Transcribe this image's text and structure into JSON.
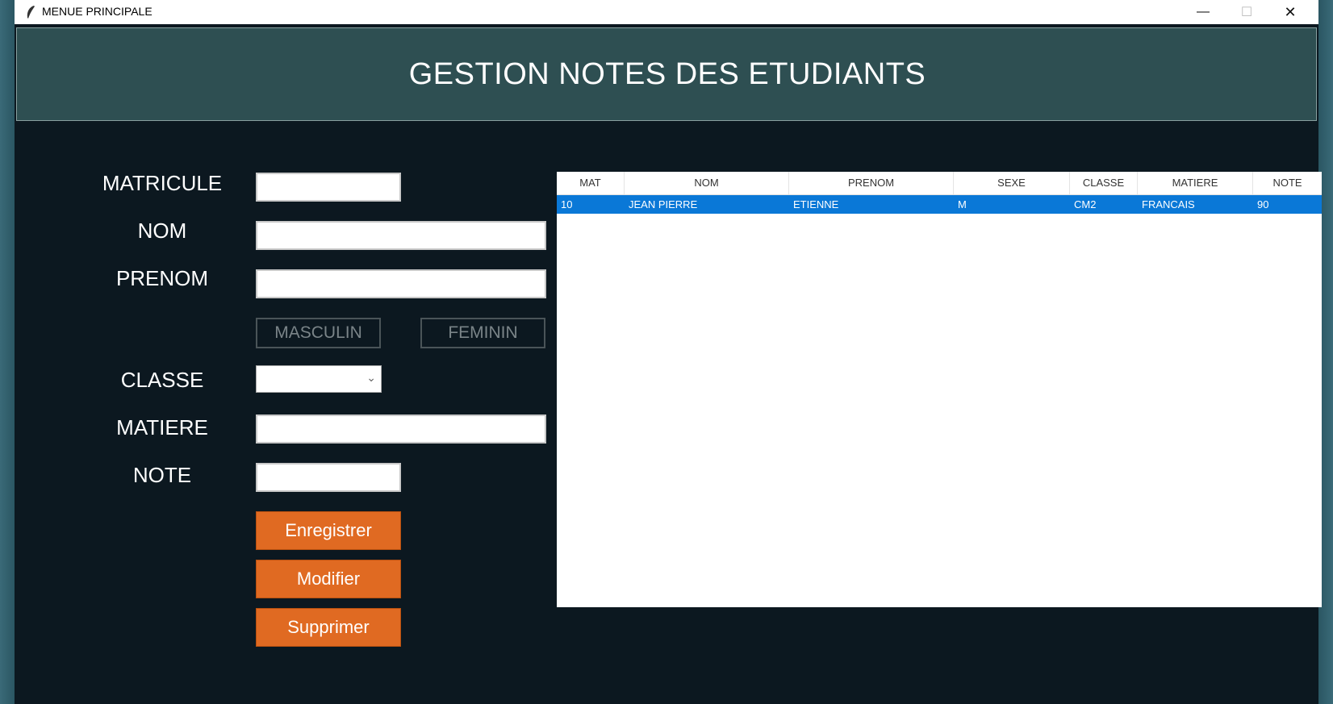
{
  "window": {
    "title": "MENUE PRINCIPALE",
    "minimize": "—",
    "maximize": "☐",
    "close": "✕"
  },
  "header": {
    "title": "GESTION NOTES DES ETUDIANTS"
  },
  "form": {
    "matricule_label": "MATRICULE",
    "nom_label": "NOM",
    "prenom_label": "PRENOM",
    "classe_label": "CLASSE",
    "matiere_label": "MATIERE",
    "note_label": "NOTE",
    "matricule_value": "",
    "nom_value": "",
    "prenom_value": "",
    "classe_value": "",
    "matiere_value": "",
    "note_value": "",
    "masculin_label": "MASCULIN",
    "feminin_label": "FEMININ"
  },
  "buttons": {
    "save": "Enregistrer",
    "modify": "Modifier",
    "delete": "Supprimer"
  },
  "table": {
    "columns": [
      "MAT",
      "NOM",
      "PRENOM",
      "SEXE",
      "CLASSE",
      "MATIERE",
      "NOTE"
    ],
    "rows": [
      [
        "10",
        "JEAN PIERRE",
        "ETIENNE",
        "M",
        "CM2",
        "FRANCAIS",
        "90"
      ]
    ],
    "selected_row_color": "#0a78d7"
  },
  "colors": {
    "accent": "#e06a22",
    "header_bg": "#2e4f52",
    "background": "#0c1820"
  }
}
